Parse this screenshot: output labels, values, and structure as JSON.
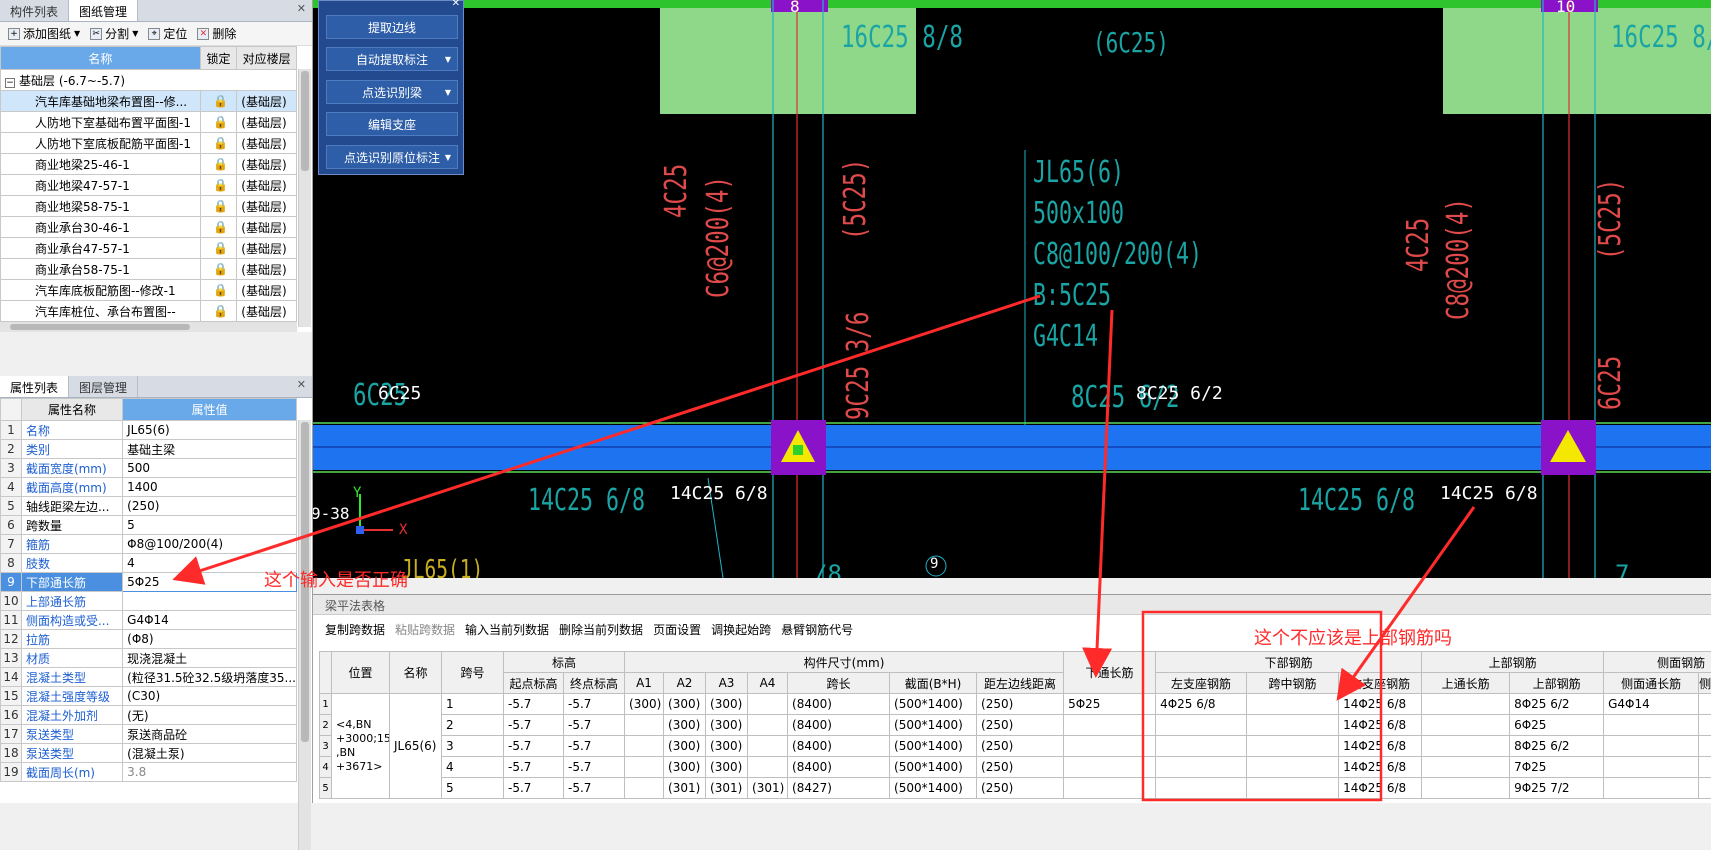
{
  "top_panel": {
    "tabs": [
      "构件列表",
      "图纸管理"
    ],
    "toolbar": [
      "添加图纸",
      "分割",
      "定位",
      "删除"
    ],
    "columns": [
      "名称",
      "锁定",
      "对应楼层"
    ],
    "group": "基础层 (-6.7~-5.7)",
    "rows": [
      {
        "name": "汽车库基础地梁布置图--修...",
        "floor": "(基础层)"
      },
      {
        "name": "人防地下室基础布置平面图-1",
        "floor": "(基础层)"
      },
      {
        "name": "人防地下室底板配筋平面图-1",
        "floor": "(基础层)"
      },
      {
        "name": "商业地梁25-46-1",
        "floor": "(基础层)"
      },
      {
        "name": "商业地梁47-57-1",
        "floor": "(基础层)"
      },
      {
        "name": "商业地梁58-75-1",
        "floor": "(基础层)"
      },
      {
        "name": "商业承台30-46-1",
        "floor": "(基础层)"
      },
      {
        "name": "商业承台47-57-1",
        "floor": "(基础层)"
      },
      {
        "name": "商业承台58-75-1",
        "floor": "(基础层)"
      },
      {
        "name": "汽车库底板配筋图--修改-1",
        "floor": "(基础层)"
      },
      {
        "name": "汽车库桩位、承台布置图--",
        "floor": "(基础层)"
      }
    ]
  },
  "props_panel": {
    "tabs": [
      "属性列表",
      "图层管理"
    ],
    "columns": [
      "属性名称",
      "属性值"
    ],
    "rows": [
      {
        "n": "1",
        "name": "名称",
        "val": "JL65(6)"
      },
      {
        "n": "2",
        "name": "类别",
        "val": "基础主梁"
      },
      {
        "n": "3",
        "name": "截面宽度(mm)",
        "val": "500"
      },
      {
        "n": "4",
        "name": "截面高度(mm)",
        "val": "1400"
      },
      {
        "n": "5",
        "name": "轴线距梁左边...",
        "val": "(250)"
      },
      {
        "n": "6",
        "name": "跨数量",
        "val": "5"
      },
      {
        "n": "7",
        "name": "箍筋",
        "val": "Φ8@100/200(4)"
      },
      {
        "n": "8",
        "name": "肢数",
        "val": "4"
      },
      {
        "n": "9",
        "name": "下部通长筋",
        "val": "5Φ25"
      },
      {
        "n": "10",
        "name": "上部通长筋",
        "val": ""
      },
      {
        "n": "11",
        "name": "侧面构造或受...",
        "val": "G4Φ14"
      },
      {
        "n": "12",
        "name": "拉筋",
        "val": "(Φ8)"
      },
      {
        "n": "13",
        "name": "材质",
        "val": "现浇混凝土"
      },
      {
        "n": "14",
        "name": "混凝土类型",
        "val": "(粒径31.5砼32.5级坍落度35..."
      },
      {
        "n": "15",
        "name": "混凝土强度等级",
        "val": "(C30)"
      },
      {
        "n": "16",
        "name": "混凝土外加剂",
        "val": "(无)"
      },
      {
        "n": "17",
        "name": "泵送类型",
        "val": "泵送商品砼"
      },
      {
        "n": "18",
        "name": "泵送类型",
        "val": "(混凝土泵)"
      },
      {
        "n": "19",
        "name": "截面周长(m)",
        "val": "3.8"
      }
    ]
  },
  "float_panel": {
    "buttons": [
      "提取边线",
      "自动提取标注",
      "点选识别梁",
      "编辑支座",
      "点选识别原位标注"
    ]
  },
  "cad": {
    "axis_8": "8",
    "axis_10": "10",
    "axis_9": "9",
    "t_16c25": "16C25 8/8",
    "t_16c25b": "16C25 8/",
    "t_6c25p": "(6C25)",
    "t_jl": "JL65(6)",
    "t_size": "500x100",
    "t_c8": "C8@100/200(4)",
    "t_b5": "B:5C25",
    "t_g4": "G4C14",
    "t_4c25": "4C25",
    "t_c6": "C6@200(4)",
    "t_5c25": "(5C25)",
    "t_4c25b": "4C25",
    "t_c8b": "C8@200(4)",
    "t_5c25b": "(5C25)",
    "t_9c": "9C25 3/6",
    "t_6c25": "6C25",
    "t_6c25w": "6C25",
    "t_8c25": "8C25 6/2",
    "t_8c25w": "8C25 6/2",
    "t_6c25r": "6C25",
    "t_14c1": "14C25 6/8",
    "t_14c1w": "14C25 6/8",
    "t_14c2": "14C25 6/8",
    "t_14c2w": "14C25 6/8",
    "t_938": "9-38",
    "t_jl65b": "JL65(1)",
    "t_axy": "Y",
    "t_axx": "X",
    "t_8": "/8",
    "t_7": "7"
  },
  "bottom": {
    "title": "梁平法表格",
    "toolbar": [
      "复制跨数据",
      "粘贴跨数据",
      "输入当前列数据",
      "删除当前列数据",
      "页面设置",
      "调换起始跨",
      "悬臂钢筋代号"
    ],
    "group_headers": [
      "标高",
      "构件尺寸(mm)",
      "下部钢筋",
      "上部钢筋",
      "侧面钢筋"
    ],
    "col_headers": [
      "位置",
      "名称",
      "跨号",
      "起点标高",
      "终点标高",
      "A1",
      "A2",
      "A3",
      "A4",
      "跨长",
      "截面(B*H)",
      "距左边线距离",
      "下通长筋",
      "左支座钢筋",
      "跨中钢筋",
      "右支座钢筋",
      "上通长筋",
      "上部钢筋",
      "侧面通长筋",
      "侧面原位标"
    ],
    "position": "<4,BN +3000;15 ,BN +3671>",
    "name": "JL65(6)",
    "rows": [
      {
        "idx": "1",
        "span": "1",
        "s": "-5.7",
        "e": "-5.7",
        "a1": "(300)",
        "a2": "(300)",
        "a3": "(300)",
        "a4": "",
        "len": "(8400)",
        "sec": "(500*1400)",
        "dist": "(250)",
        "bot": "5Φ25",
        "left": "4Φ25 6/8",
        "mid": "",
        "right": "14Φ25 6/8",
        "top": "",
        "upper": "8Φ25 6/2",
        "side": "G4Φ14"
      },
      {
        "idx": "2",
        "span": "2",
        "s": "-5.7",
        "e": "-5.7",
        "a1": "",
        "a2": "(300)",
        "a3": "(300)",
        "a4": "",
        "len": "(8400)",
        "sec": "(500*1400)",
        "dist": "(250)",
        "bot": "",
        "left": "",
        "mid": "",
        "right": "14Φ25 6/8",
        "top": "",
        "upper": "6Φ25",
        "side": ""
      },
      {
        "idx": "3",
        "span": "3",
        "s": "-5.7",
        "e": "-5.7",
        "a1": "",
        "a2": "(300)",
        "a3": "(300)",
        "a4": "",
        "len": "(8400)",
        "sec": "(500*1400)",
        "dist": "(250)",
        "bot": "",
        "left": "",
        "mid": "",
        "right": "14Φ25 6/8",
        "top": "",
        "upper": "8Φ25 6/2",
        "side": ""
      },
      {
        "idx": "4",
        "span": "4",
        "s": "-5.7",
        "e": "-5.7",
        "a1": "",
        "a2": "(300)",
        "a3": "(300)",
        "a4": "",
        "len": "(8400)",
        "sec": "(500*1400)",
        "dist": "(250)",
        "bot": "",
        "left": "",
        "mid": "",
        "right": "14Φ25 6/8",
        "top": "",
        "upper": "7Φ25",
        "side": ""
      },
      {
        "idx": "5",
        "span": "5",
        "s": "-5.7",
        "e": "-5.7",
        "a1": "",
        "a2": "(301)",
        "a3": "(301)",
        "a4": "(301)",
        "len": "(8427)",
        "sec": "(500*1400)",
        "dist": "(250)",
        "bot": "",
        "left": "",
        "mid": "",
        "right": "14Φ25 6/8",
        "top": "",
        "upper": "9Φ25 7/2",
        "side": ""
      }
    ]
  },
  "annotations": {
    "q1": "这个输入是否正确",
    "q2": "这个不应该是上部钢筋吗"
  },
  "colors": {
    "cad_bg": "#000000",
    "beam": "#1e73f0",
    "green_block": "#8fd88a",
    "annotation": "#ff2a2a",
    "header": "#6aa9e9"
  }
}
